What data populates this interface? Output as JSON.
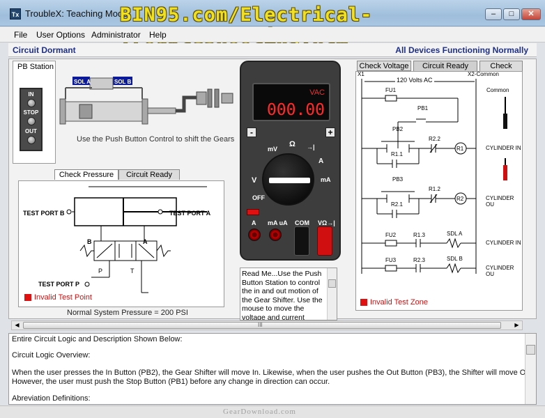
{
  "window": {
    "title": "TroubleX: Teaching Mode",
    "icon_text": "Tx",
    "watermark": "BIN95.com/Electrical-Troubleshooting.htm",
    "minimize_glyph": "–",
    "maximize_glyph": "□",
    "close_glyph": "✕"
  },
  "menu": {
    "file": "File",
    "user_options": "User Options",
    "administrator": "Administrator",
    "help": "Help"
  },
  "status": {
    "left": "Circuit Dormant",
    "right": "All Devices Functioning Normally"
  },
  "pb_station": {
    "title": "PB Station",
    "in_label": "IN",
    "stop_label": "STOP",
    "out_label": "OUT",
    "sol_a": "SOL A",
    "sol_b": "SOL B",
    "instruction": "Use the Push Button Control to shift the Gears"
  },
  "pressure_panel": {
    "tab_check": "Check Pressure",
    "tab_ready": "Circuit Ready",
    "test_port_b": "TEST PORT B",
    "test_port_a": "TEST PORT A",
    "test_port_p": "TEST PORT P",
    "valve_b": "B",
    "valve_a": "A",
    "valve_p": "P",
    "valve_t": "T",
    "invalid": "Invalid Test Point",
    "footer": "Normal System Pressure = 200 PSI"
  },
  "meter": {
    "unit": "VAC",
    "value": "000.00",
    "minus": "-",
    "plus": "+",
    "mv": "mV",
    "ohm": "Ω",
    "diode": "→|",
    "v_label": "V",
    "a_label": "A",
    "ma_label": "mA",
    "off": "OFF",
    "jack_a": "A",
    "jack_ma": "mA uA",
    "jack_com": "COM",
    "jack_v": "VΩ→|"
  },
  "readme": {
    "text": "Read Me...Use the Push Button Station to control the in and out motion of the Gear Shifter. Use the mouse to move the voltage and current probes throughout the"
  },
  "circuit": {
    "tab_voltage": "Check Voltage",
    "tab_ready": "Circuit Ready",
    "tab_current": "Check Curre",
    "x1": "X1",
    "x2": "X2-Common",
    "supply": "120 Volts AC",
    "common": "Common",
    "fu1": "FU1",
    "pb1": "PB1",
    "pb2": "PB2",
    "r22": "R2.2",
    "r11": "R1.1",
    "r1": "R1",
    "cyl_in": "CYLINDER IN",
    "pb3": "PB3",
    "r12": "R1.2",
    "r21": "R2.1",
    "r2": "R2",
    "cyl_out": "CYLINDER OU",
    "fu2": "FU2",
    "r13": "R1.3",
    "sdla": "SDL A",
    "fu3": "FU3",
    "r23": "R2.3",
    "sdlb": "SDL B",
    "invalid": "Invalid Test Zone"
  },
  "description": {
    "lines": [
      "Entire Circuit Logic and Description Shown Below:",
      "Circuit Logic Overview:",
      "When the user presses the In Button (PB2), the Gear Shifter will move In. Likewise, when the user pushes the Out Button (PB3), the Shifter will move Out.",
      "However, the user must push the Stop Button (PB1) before any change in direction can occur.",
      "Abreviation Definitions:"
    ]
  },
  "scroll": {
    "grip": "III"
  },
  "footer": {
    "text": "GearDownload.com"
  }
}
